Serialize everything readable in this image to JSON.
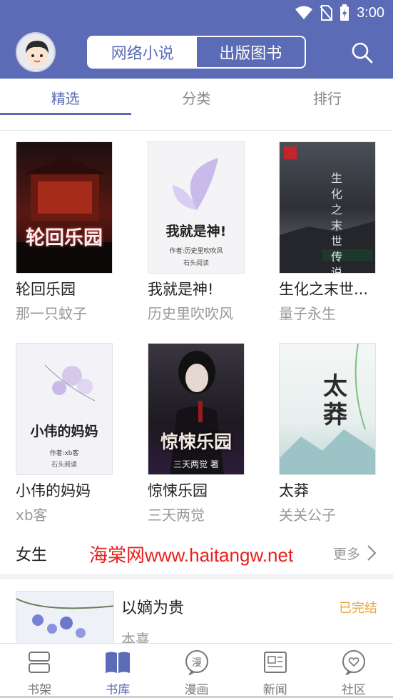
{
  "status": {
    "time": "3:00"
  },
  "header": {
    "segments": [
      "网络小说",
      "出版图书"
    ],
    "active_segment": 0
  },
  "tabs": {
    "items": [
      "精选",
      "分类",
      "排行"
    ],
    "active": 0
  },
  "books": [
    {
      "title": "轮回乐园",
      "author": "那一只蚊子",
      "cover_text": "轮回乐园"
    },
    {
      "title": "我就是神!",
      "author": "历史里吹吹风",
      "cover_text": "我就是神!",
      "cover_sub": "作者:历史里吹吹风",
      "cover_brand": "石头阅读"
    },
    {
      "title": "生化之末世...",
      "author": "量子永生",
      "cover_text": "生化之末世传说"
    },
    {
      "title": "小伟的妈妈",
      "author": "xb客",
      "cover_text": "小伟的妈妈",
      "cover_sub": "作者:xb客",
      "cover_brand": "石头阅读"
    },
    {
      "title": "惊悚乐园",
      "author": "三天两觉",
      "cover_text": "惊悚乐园",
      "cover_sub": "三天两觉 著"
    },
    {
      "title": "太莽",
      "author": "关关公子",
      "cover_text": "太莽"
    }
  ],
  "section": {
    "title": "女生",
    "more": "更多",
    "watermark": "海棠网www.haitangw.net"
  },
  "list_item": {
    "title": "以嫡为贵",
    "status": "已完结",
    "author": "本喜"
  },
  "bottom_nav": {
    "items": [
      "书架",
      "书库",
      "漫画",
      "新闻",
      "社区"
    ],
    "active": 1
  },
  "colors": {
    "accent": "#5b6bb5",
    "complete": "#e8a53a",
    "watermark": "#e8201d"
  }
}
